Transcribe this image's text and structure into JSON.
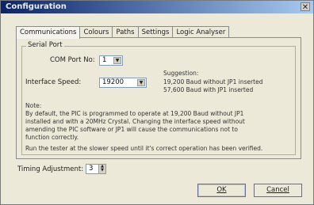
{
  "window": {
    "title": "Configuration"
  },
  "tabs": [
    {
      "label": "Communications",
      "active": true
    },
    {
      "label": "Colours",
      "active": false
    },
    {
      "label": "Paths",
      "active": false
    },
    {
      "label": "Settings",
      "active": false
    },
    {
      "label": "Logic Analyser",
      "active": false
    }
  ],
  "serial_port": {
    "group_label": "Serial Port",
    "com_port_label": "COM Port No:",
    "com_port_value": "1",
    "speed_label": "Interface Speed:",
    "speed_value": "19200",
    "suggestion_title": "Suggestion:",
    "suggestion_line1": "19,200 Baud without JP1 inserted",
    "suggestion_line2": "57,600 Baud with JP1 inserted",
    "note_title": "Note:",
    "note_line1": "By default, the PIC is programmed to operate at 19,200 Baud without JP1",
    "note_line2": "installed and with a 20MHz Crystal. Changing the interface speed without",
    "note_line3": "amending the PIC software or JP1 will cause the communications not to",
    "note_line4": "function correctly.",
    "note_line5": "Run the tester at the slower speed until it's correct operation has been verified."
  },
  "timing": {
    "label": "Timing Adjustment:",
    "value": "3"
  },
  "buttons": {
    "ok": "OK",
    "cancel": "Cancel"
  },
  "colors": {
    "title_start": "#0a246a",
    "title_end": "#a6caf0",
    "face": "#ece9d8"
  }
}
